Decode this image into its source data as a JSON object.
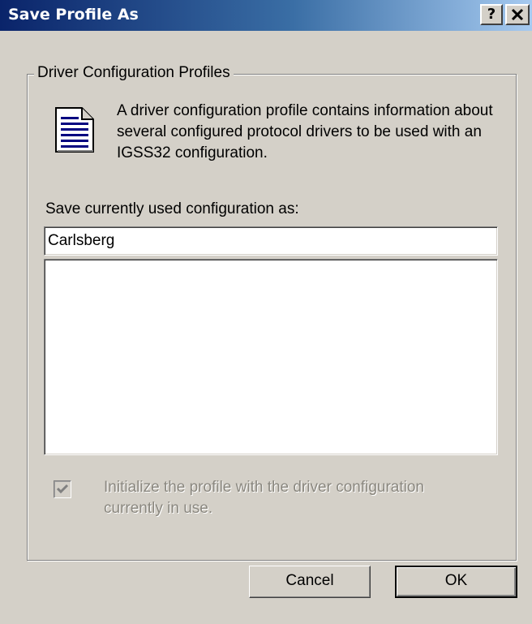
{
  "window": {
    "title": "Save Profile As",
    "help_button": "?",
    "close_button": "✕"
  },
  "group": {
    "legend": "Driver Configuration Profiles",
    "icon": "document-icon",
    "description": "A driver configuration profile contains information about several configured protocol drivers to be used with an IGSS32 configuration."
  },
  "form": {
    "save_label": "Save currently used configuration as:",
    "name_value": "Carlsberg",
    "profiles": [],
    "initialize_checked": true,
    "initialize_enabled": false,
    "initialize_label": "Initialize the profile with the driver configuration currently in use."
  },
  "buttons": {
    "cancel": "Cancel",
    "ok": "OK"
  },
  "colors": {
    "title_gradient_start": "#0a246a",
    "title_gradient_end": "#a6caf0",
    "dialog_face": "#d4d0c8",
    "disabled_text": "#8a877f"
  }
}
